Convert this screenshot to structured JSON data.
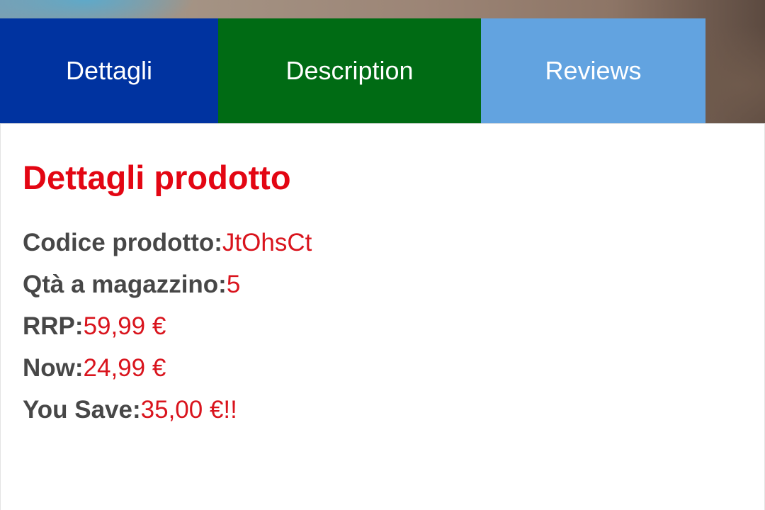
{
  "colors": {
    "tab_details_bg": "#0033a0",
    "tab_description_bg": "#006b14",
    "tab_reviews_bg": "#62a3e0",
    "accent_red": "#e30613",
    "value_red": "#d9141d",
    "label_gray": "#474747"
  },
  "tabs": [
    {
      "label": "Dettagli",
      "color": "#0033a0"
    },
    {
      "label": "Description",
      "color": "#006b14"
    },
    {
      "label": "Reviews",
      "color": "#62a3e0"
    }
  ],
  "details": {
    "title": "Dettagli prodotto",
    "rows": [
      {
        "label": "Codice prodotto:",
        "value": "JtOhsCt"
      },
      {
        "label": "Qtà a magazzino:",
        "value": "5"
      },
      {
        "label": "RRP:",
        "value": "59,99 €"
      },
      {
        "label": "Now:",
        "value": "24,99 €"
      },
      {
        "label": "You Save:",
        "value": "35,00 €!!"
      }
    ]
  }
}
